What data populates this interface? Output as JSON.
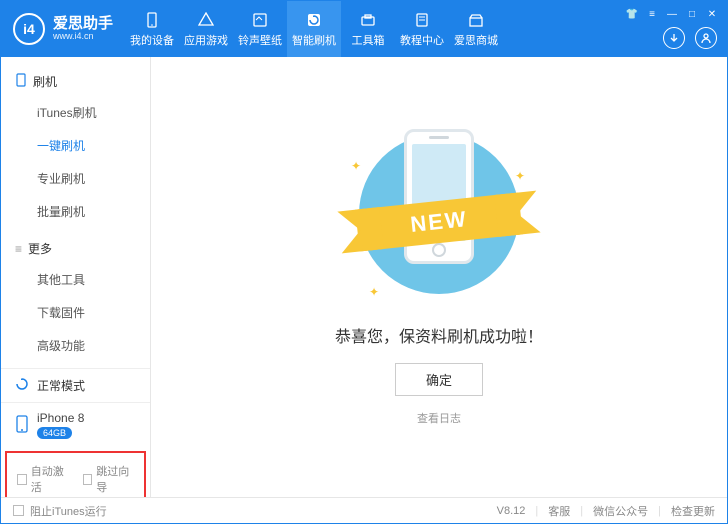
{
  "header": {
    "brand": "爱思助手",
    "url": "www.i4.cn",
    "logo_text": "i4",
    "nav": [
      {
        "label": "我的设备",
        "icon": "device"
      },
      {
        "label": "应用游戏",
        "icon": "apps"
      },
      {
        "label": "铃声壁纸",
        "icon": "media"
      },
      {
        "label": "智能刷机",
        "icon": "flash",
        "active": true
      },
      {
        "label": "工具箱",
        "icon": "tools"
      },
      {
        "label": "教程中心",
        "icon": "book"
      },
      {
        "label": "爱思商城",
        "icon": "shop"
      }
    ]
  },
  "sidebar": {
    "groups": [
      {
        "title": "刷机",
        "items": [
          "iTunes刷机",
          "一键刷机",
          "专业刷机",
          "批量刷机"
        ],
        "active_index": 1
      },
      {
        "title": "更多",
        "items": [
          "其他工具",
          "下载固件",
          "高级功能"
        ]
      }
    ],
    "status": {
      "label": "正常模式"
    },
    "device": {
      "name": "iPhone 8",
      "storage": "64GB"
    },
    "checks": {
      "auto_activate": "自动激活",
      "skip_guide": "跳过向导"
    }
  },
  "content": {
    "ribbon": "NEW",
    "success": "恭喜您，保资料刷机成功啦！",
    "ok": "确定",
    "log": "查看日志"
  },
  "footer": {
    "block_itunes": "阻止iTunes运行",
    "version": "V8.12",
    "links": [
      "客服",
      "微信公众号",
      "检查更新"
    ]
  }
}
